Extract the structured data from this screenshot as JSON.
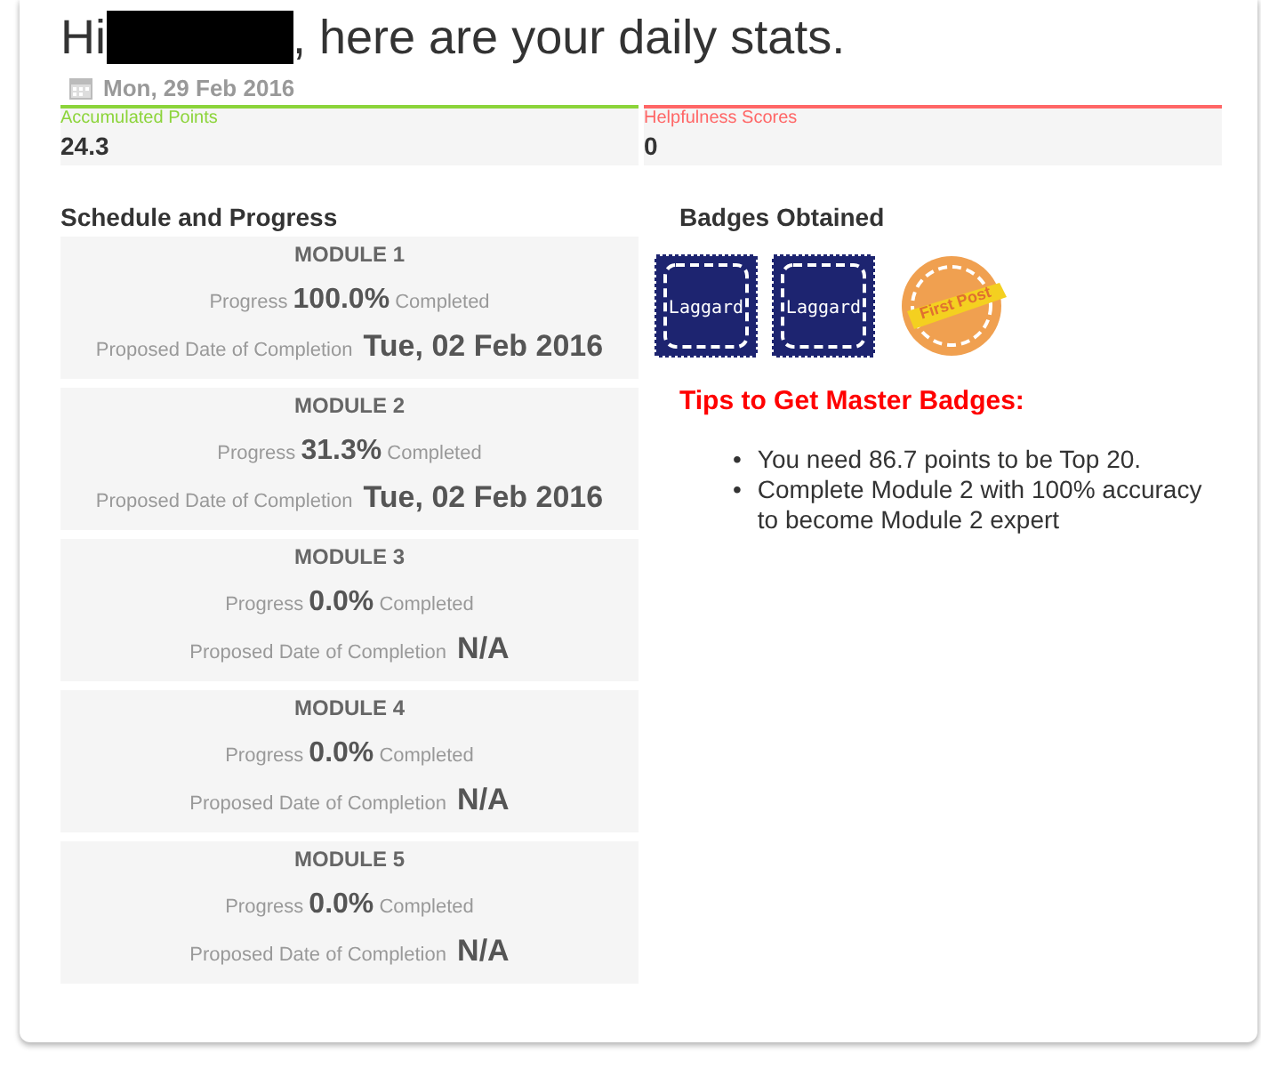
{
  "greeting": {
    "before": "Hi",
    "after": ", here are your daily stats.",
    "date": "Mon, 29 Feb 2016"
  },
  "stats": [
    {
      "label": "Accumulated Points",
      "value": "24.3",
      "color": "#8cd43a"
    },
    {
      "label": "Helpfulness Scores",
      "value": "0",
      "color": "#ff6666"
    }
  ],
  "schedule": {
    "title": "Schedule and Progress",
    "modules": [
      {
        "name": "MODULE 1",
        "progress_label": "Progress",
        "progress": "100.0%",
        "completed_label": "Completed",
        "date_label": "Proposed Date of Completion",
        "date": "Tue, 02 Feb 2016"
      },
      {
        "name": "MODULE 2",
        "progress_label": "Progress",
        "progress": "31.3%",
        "completed_label": "Completed",
        "date_label": "Proposed Date of Completion",
        "date": "Tue, 02 Feb 2016"
      },
      {
        "name": "MODULE 3",
        "progress_label": "Progress",
        "progress": "0.0%",
        "completed_label": "Completed",
        "date_label": "Proposed Date of Completion",
        "date": "N/A"
      },
      {
        "name": "MODULE 4",
        "progress_label": "Progress",
        "progress": "0.0%",
        "completed_label": "Completed",
        "date_label": "Proposed Date of Completion",
        "date": "N/A"
      },
      {
        "name": "MODULE 5",
        "progress_label": "Progress",
        "progress": "0.0%",
        "completed_label": "Completed",
        "date_label": "Proposed Date of Completion",
        "date": "N/A"
      }
    ]
  },
  "badges": {
    "title": "Badges Obtained",
    "items": [
      {
        "kind": "stamp",
        "label": "Laggard"
      },
      {
        "kind": "stamp",
        "label": "Laggard"
      },
      {
        "kind": "seal",
        "label": "First Post"
      }
    ]
  },
  "tips": {
    "title": "Tips to Get Master Badges:",
    "items": [
      {
        "bullet": "•",
        "text": "You need 86.7 points to be Top 20."
      },
      {
        "bullet": "•",
        "text": "Complete Module 2 with 100% accuracy to become Module 2 expert"
      }
    ]
  }
}
